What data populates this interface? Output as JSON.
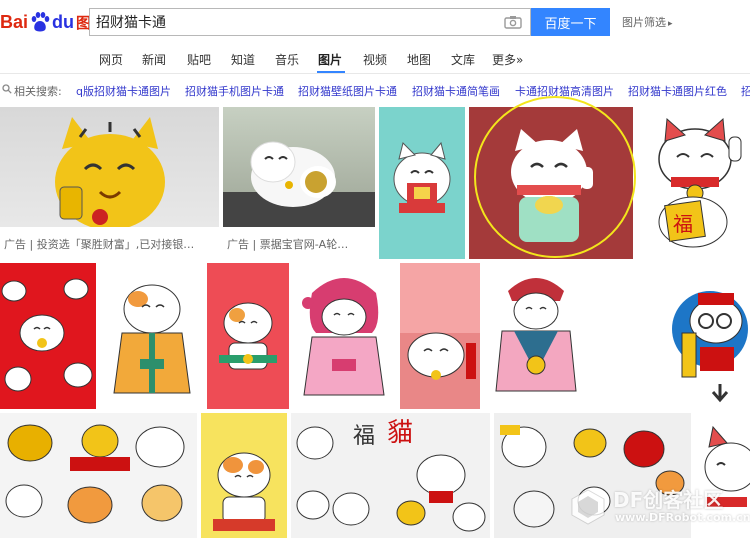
{
  "logo": {
    "bai": "Bai",
    "du": "du",
    "pic": "图片"
  },
  "search": {
    "query": "招财猫卡通",
    "button": "百度一下",
    "filter_link": "图片筛选"
  },
  "tabs": [
    {
      "label": "网页"
    },
    {
      "label": "新闻"
    },
    {
      "label": "贴吧"
    },
    {
      "label": "知道"
    },
    {
      "label": "音乐"
    },
    {
      "label": "图片",
      "active": true
    },
    {
      "label": "视频"
    },
    {
      "label": "地图"
    },
    {
      "label": "文库"
    },
    {
      "label": "更多»"
    }
  ],
  "related": {
    "label": "相关搜索:",
    "items": [
      "q版招财猫卡通图片",
      "招财猫手机图片卡通",
      "招财猫壁纸图片卡通",
      "招财猫卡通简笔画",
      "卡通招财猫高清图片",
      "招财猫卡通图片红色",
      "招"
    ]
  },
  "ads": [
    {
      "text": "广告 | 投资选「聚胜财富」,已对接银…"
    },
    {
      "text": "广告 | 票据宝官网-A轮…"
    }
  ],
  "watermark": {
    "line1": "DF创客社区",
    "line2": "www.DFRobot.com.cn"
  },
  "colors": {
    "accent": "#3385ff",
    "link": "#3338cc",
    "highlight_circle": "#f3e61c"
  },
  "icons": [
    "camera-icon",
    "magnifier-icon",
    "down-arrow-icon"
  ]
}
